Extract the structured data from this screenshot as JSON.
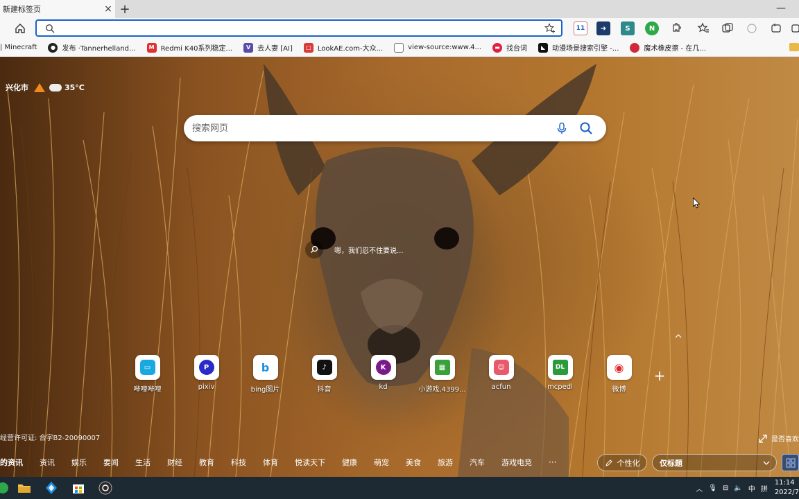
{
  "tab": {
    "title": "新建标签页",
    "close": "×",
    "new": "+"
  },
  "window": {
    "minimize": "—"
  },
  "bookmarks": [
    {
      "label": "| Minecraft",
      "icon": "none",
      "color": ""
    },
    {
      "label": "发布 ·Tannerhelland...",
      "icon": "github-icon",
      "color": "#222222"
    },
    {
      "label": "Redmi K40系列稳定...",
      "icon": "redmi-icon",
      "color": "#e03030"
    },
    {
      "label": "去人妻 [AI]",
      "icon": "v-icon",
      "color": "#5a4ba8"
    },
    {
      "label": "LookAE.com-大众...",
      "icon": "lookae-icon",
      "color": "#d83a3a"
    },
    {
      "label": "view-source:www.4...",
      "icon": "page-icon",
      "color": "#777777"
    },
    {
      "label": "找台词",
      "icon": "taici-icon",
      "color": "#e02040"
    },
    {
      "label": "动漫场景搜索引擎 -...",
      "icon": "anime-icon",
      "color": "#111111"
    },
    {
      "label": "魔术橡皮擦 - 在几...",
      "icon": "eraser-icon",
      "color": "#d02a3a"
    }
  ],
  "weather": {
    "city": "兴化市",
    "temp": "35°C"
  },
  "search": {
    "placeholder": "搜索网页"
  },
  "quote": {
    "text": "嗯，我们忍不住要说..."
  },
  "quick_links": [
    {
      "label": "哔哩哔哩",
      "icon": "bilibili-icon",
      "color": "#19a9e1",
      "glyph": "▭"
    },
    {
      "label": "pixiv",
      "icon": "pixiv-icon",
      "color": "#2a2ac8",
      "glyph": "P"
    },
    {
      "label": "bing图片",
      "icon": "bing-icon",
      "color": "#1a8fe3",
      "glyph": "b"
    },
    {
      "label": "抖音",
      "icon": "douyin-icon",
      "color": "#111111",
      "glyph": "♪"
    },
    {
      "label": "kd",
      "icon": "kd-icon",
      "color": "#7a1a8a",
      "glyph": "K"
    },
    {
      "label": "小游戏,4399...",
      "icon": "4399-icon",
      "color": "#3aa03a",
      "glyph": "▦"
    },
    {
      "label": "acfun",
      "icon": "acfun-icon",
      "color": "#e85a6a",
      "glyph": "☺"
    },
    {
      "label": "mcpedl",
      "icon": "mcpedl-icon",
      "color": "#2a9a3a",
      "glyph": "DL"
    },
    {
      "label": "微博",
      "icon": "weibo-icon",
      "color": "#e02a2a",
      "glyph": "◉"
    }
  ],
  "icp": "经营许可证: 合字B2-20090007",
  "expand_label": "是否喜欢",
  "feed": {
    "items": [
      "的资讯",
      "资讯",
      "娱乐",
      "要闻",
      "生活",
      "财经",
      "教育",
      "科技",
      "体育",
      "悦读天下",
      "健康",
      "萌宠",
      "美食",
      "旅游",
      "汽车",
      "游戏电竞"
    ],
    "more": "···",
    "personalize": "个性化",
    "dropdown": "仅标题"
  },
  "taskbar": {
    "time": "11:14",
    "date": "2022/7",
    "ime": "中",
    "colors": {
      "bg": "#1d2a33"
    }
  },
  "colors": {
    "accent": "#1a62c6",
    "chrome": "#f7f7f7"
  }
}
